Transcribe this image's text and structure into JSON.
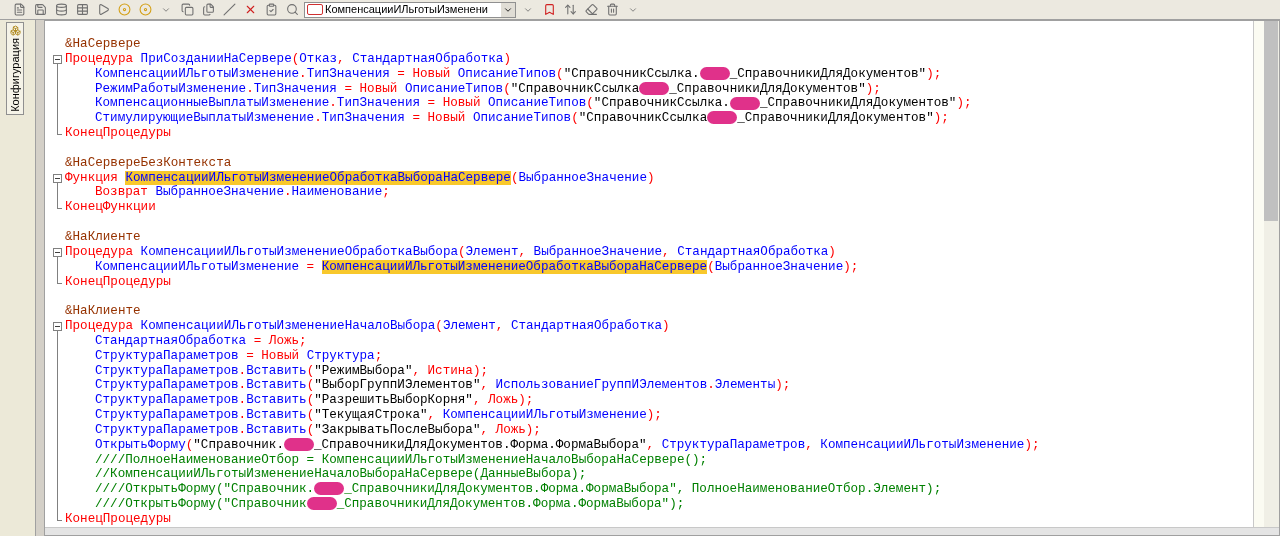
{
  "toolbar": {
    "method_selector": {
      "value": "КомпенсацииИЛьготыИзменени"
    }
  },
  "sidebar": {
    "tab": {
      "label": "Конфигурация",
      "selected": true
    }
  },
  "editor": {
    "items": [
      {
        "kind": "line",
        "tokens": [
          {
            "kind": "dir",
            "text": "&НаСервере"
          }
        ]
      },
      {
        "kind": "block",
        "header": [
          {
            "kind": "kw",
            "text": "Процедура "
          },
          {
            "kind": "id",
            "text": "ПриСозданииНаСервере"
          },
          {
            "kind": "op",
            "text": "("
          },
          {
            "kind": "id",
            "text": "Отказ"
          },
          {
            "kind": "op",
            "text": ", "
          },
          {
            "kind": "id",
            "text": "СтандартнаяОбработка"
          },
          {
            "kind": "op",
            "text": ")"
          }
        ],
        "children": [
          [
            {
              "kind": "id",
              "text": "КомпенсацииИЛьготыИзменение"
            },
            {
              "kind": "op",
              "text": "."
            },
            {
              "kind": "id",
              "text": "ТипЗначения"
            },
            {
              "kind": "op",
              "text": " = "
            },
            {
              "kind": "kw",
              "text": "Новый "
            },
            {
              "kind": "id",
              "text": "ОписаниеТипов"
            },
            {
              "kind": "op",
              "text": "("
            },
            {
              "kind": "str",
              "text": "\"СправочникСсылка."
            },
            {
              "kind": "redacted"
            },
            {
              "kind": "str",
              "text": "_СправочникиДляДокументов\""
            },
            {
              "kind": "op",
              "text": ");"
            }
          ],
          [
            {
              "kind": "id",
              "text": "РежимРаботыИзменение"
            },
            {
              "kind": "op",
              "text": "."
            },
            {
              "kind": "id",
              "text": "ТипЗначения"
            },
            {
              "kind": "op",
              "text": " = "
            },
            {
              "kind": "kw",
              "text": "Новый "
            },
            {
              "kind": "id",
              "text": "ОписаниеТипов"
            },
            {
              "kind": "op",
              "text": "("
            },
            {
              "kind": "str",
              "text": "\"СправочникСсылка"
            },
            {
              "kind": "redacted"
            },
            {
              "kind": "str",
              "text": "_СправочникиДляДокументов\""
            },
            {
              "kind": "op",
              "text": ");"
            }
          ],
          [
            {
              "kind": "id",
              "text": "КомпенсационныеВыплатыИзменение"
            },
            {
              "kind": "op",
              "text": "."
            },
            {
              "kind": "id",
              "text": "ТипЗначения"
            },
            {
              "kind": "op",
              "text": " = "
            },
            {
              "kind": "kw",
              "text": "Новый "
            },
            {
              "kind": "id",
              "text": "ОписаниеТипов"
            },
            {
              "kind": "op",
              "text": "("
            },
            {
              "kind": "str",
              "text": "\"СправочникСсылка."
            },
            {
              "kind": "redacted"
            },
            {
              "kind": "str",
              "text": "_СправочникиДляДокументов\""
            },
            {
              "kind": "op",
              "text": ");"
            }
          ],
          [
            {
              "kind": "id",
              "text": "СтимулирующиеВыплатыИзменение"
            },
            {
              "kind": "op",
              "text": "."
            },
            {
              "kind": "id",
              "text": "ТипЗначения"
            },
            {
              "kind": "op",
              "text": " = "
            },
            {
              "kind": "kw",
              "text": "Новый "
            },
            {
              "kind": "id",
              "text": "ОписаниеТипов"
            },
            {
              "kind": "op",
              "text": "("
            },
            {
              "kind": "str",
              "text": "\"СправочникСсылка"
            },
            {
              "kind": "redacted"
            },
            {
              "kind": "str",
              "text": "_СправочникиДляДокументов\""
            },
            {
              "kind": "op",
              "text": ");"
            }
          ]
        ],
        "footer": [
          {
            "kind": "kw",
            "text": "КонецПроцедуры"
          }
        ]
      },
      {
        "kind": "blank"
      },
      {
        "kind": "line",
        "tokens": [
          {
            "kind": "dir",
            "text": "&НаСервереБезКонтекста"
          }
        ]
      },
      {
        "kind": "block",
        "header": [
          {
            "kind": "kw",
            "text": "Функция "
          },
          {
            "kind": "hl",
            "text": "КомпенсацииИЛьготыИзменениеОбработкаВыбораНаСервере"
          },
          {
            "kind": "op",
            "text": "("
          },
          {
            "kind": "id",
            "text": "ВыбранноеЗначение"
          },
          {
            "kind": "op",
            "text": ")"
          }
        ],
        "children": [
          [
            {
              "kind": "kw",
              "text": "Возврат "
            },
            {
              "kind": "id",
              "text": "ВыбранноеЗначение"
            },
            {
              "kind": "op",
              "text": "."
            },
            {
              "kind": "id",
              "text": "Наименование"
            },
            {
              "kind": "op",
              "text": ";"
            }
          ]
        ],
        "footer": [
          {
            "kind": "kw",
            "text": "КонецФункции"
          }
        ]
      },
      {
        "kind": "blank"
      },
      {
        "kind": "line",
        "tokens": [
          {
            "kind": "dir",
            "text": "&НаКлиенте"
          }
        ]
      },
      {
        "kind": "block",
        "header": [
          {
            "kind": "kw",
            "text": "Процедура "
          },
          {
            "kind": "id",
            "text": "КомпенсацииИЛьготыИзменениеОбработкаВыбора"
          },
          {
            "kind": "op",
            "text": "("
          },
          {
            "kind": "id",
            "text": "Элемент"
          },
          {
            "kind": "op",
            "text": ", "
          },
          {
            "kind": "id",
            "text": "ВыбранноеЗначение"
          },
          {
            "kind": "op",
            "text": ", "
          },
          {
            "kind": "id",
            "text": "СтандартнаяОбработка"
          },
          {
            "kind": "op",
            "text": ")"
          }
        ],
        "children": [
          [
            {
              "kind": "id",
              "text": "КомпенсацииИЛьготыИзменение"
            },
            {
              "kind": "op",
              "text": " = "
            },
            {
              "kind": "hl",
              "text": "КомпенсацииИЛьготыИзменениеОбработкаВыбораНаСервере"
            },
            {
              "kind": "op",
              "text": "("
            },
            {
              "kind": "id",
              "text": "ВыбранноеЗначение"
            },
            {
              "kind": "op",
              "text": ");"
            }
          ]
        ],
        "footer": [
          {
            "kind": "kw",
            "text": "КонецПроцедуры"
          }
        ]
      },
      {
        "kind": "blank"
      },
      {
        "kind": "line",
        "tokens": [
          {
            "kind": "dir",
            "text": "&НаКлиенте"
          }
        ]
      },
      {
        "kind": "block",
        "header": [
          {
            "kind": "kw",
            "text": "Процедура "
          },
          {
            "kind": "id",
            "text": "КомпенсацииИЛьготыИзменениеНачалоВыбора"
          },
          {
            "kind": "op",
            "text": "("
          },
          {
            "kind": "id",
            "text": "Элемент"
          },
          {
            "kind": "op",
            "text": ", "
          },
          {
            "kind": "id",
            "text": "СтандартнаяОбработка"
          },
          {
            "kind": "op",
            "text": ")"
          }
        ],
        "children": [
          [
            {
              "kind": "id",
              "text": "СтандартнаяОбработка"
            },
            {
              "kind": "op",
              "text": " = "
            },
            {
              "kind": "kw",
              "text": "Ложь"
            },
            {
              "kind": "op",
              "text": ";"
            }
          ],
          [
            {
              "kind": "id",
              "text": "СтруктураПараметров"
            },
            {
              "kind": "op",
              "text": " = "
            },
            {
              "kind": "kw",
              "text": "Новый "
            },
            {
              "kind": "id",
              "text": "Структура"
            },
            {
              "kind": "op",
              "text": ";"
            }
          ],
          [
            {
              "kind": "id",
              "text": "СтруктураПараметров"
            },
            {
              "kind": "op",
              "text": "."
            },
            {
              "kind": "id",
              "text": "Вставить"
            },
            {
              "kind": "op",
              "text": "("
            },
            {
              "kind": "str",
              "text": "\"РежимВыбора\""
            },
            {
              "kind": "op",
              "text": ", "
            },
            {
              "kind": "kw",
              "text": "Истина"
            },
            {
              "kind": "op",
              "text": ");"
            }
          ],
          [
            {
              "kind": "id",
              "text": "СтруктураПараметров"
            },
            {
              "kind": "op",
              "text": "."
            },
            {
              "kind": "id",
              "text": "Вставить"
            },
            {
              "kind": "op",
              "text": "("
            },
            {
              "kind": "str",
              "text": "\"ВыборГруппИЭлементов\""
            },
            {
              "kind": "op",
              "text": ", "
            },
            {
              "kind": "id",
              "text": "ИспользованиеГруппИЭлементов"
            },
            {
              "kind": "op",
              "text": "."
            },
            {
              "kind": "id",
              "text": "Элементы"
            },
            {
              "kind": "op",
              "text": ");"
            }
          ],
          [
            {
              "kind": "id",
              "text": "СтруктураПараметров"
            },
            {
              "kind": "op",
              "text": "."
            },
            {
              "kind": "id",
              "text": "Вставить"
            },
            {
              "kind": "op",
              "text": "("
            },
            {
              "kind": "str",
              "text": "\"РазрешитьВыборКорня\""
            },
            {
              "kind": "op",
              "text": ", "
            },
            {
              "kind": "kw",
              "text": "Ложь"
            },
            {
              "kind": "op",
              "text": ");"
            }
          ],
          [
            {
              "kind": "id",
              "text": "СтруктураПараметров"
            },
            {
              "kind": "op",
              "text": "."
            },
            {
              "kind": "id",
              "text": "Вставить"
            },
            {
              "kind": "op",
              "text": "("
            },
            {
              "kind": "str",
              "text": "\"ТекущаяСтрока\""
            },
            {
              "kind": "op",
              "text": ", "
            },
            {
              "kind": "id",
              "text": "КомпенсацииИЛьготыИзменение"
            },
            {
              "kind": "op",
              "text": ");"
            }
          ],
          [
            {
              "kind": "id",
              "text": "СтруктураПараметров"
            },
            {
              "kind": "op",
              "text": "."
            },
            {
              "kind": "id",
              "text": "Вставить"
            },
            {
              "kind": "op",
              "text": "("
            },
            {
              "kind": "str",
              "text": "\"ЗакрыватьПослеВыбора\""
            },
            {
              "kind": "op",
              "text": ", "
            },
            {
              "kind": "kw",
              "text": "Ложь"
            },
            {
              "kind": "op",
              "text": ");"
            }
          ],
          [
            {
              "kind": "id",
              "text": "ОткрытьФорму"
            },
            {
              "kind": "op",
              "text": "("
            },
            {
              "kind": "str",
              "text": "\"Справочник."
            },
            {
              "kind": "redacted"
            },
            {
              "kind": "str",
              "text": "_СправочникиДляДокументов.Форма.ФормаВыбора\""
            },
            {
              "kind": "op",
              "text": ", "
            },
            {
              "kind": "id",
              "text": "СтруктураПараметров"
            },
            {
              "kind": "op",
              "text": ", "
            },
            {
              "kind": "id",
              "text": "КомпенсацииИЛьготыИзменение"
            },
            {
              "kind": "op",
              "text": ");"
            }
          ],
          [
            {
              "kind": "cm",
              "text": "////ПолноеНаименованиеОтбор = КомпенсацииИЛьготыИзменениеНачалоВыбораНаСервере();"
            }
          ],
          [
            {
              "kind": "cm",
              "text": "//КомпенсацииИЛьготыИзменениеНачалоВыбораНаСервере(ДанныеВыбора);"
            }
          ],
          [
            {
              "kind": "cm",
              "text": "////ОткрытьФорму(\"Справочник."
            },
            {
              "kind": "redacted"
            },
            {
              "kind": "cm",
              "text": "_СправочникиДляДокументов.Форма.ФормаВыбора\", ПолноеНаименованиеОтбор.Элемент);"
            }
          ],
          [
            {
              "kind": "cm",
              "text": "////ОткрытьФорму(\"Справочник"
            },
            {
              "kind": "redacted"
            },
            {
              "kind": "cm",
              "text": "_СправочникиДляДокументов.Форма.ФормаВыбора\");"
            }
          ]
        ],
        "footer": [
          {
            "kind": "kw",
            "text": "КонецПроцедуры"
          }
        ]
      }
    ]
  }
}
